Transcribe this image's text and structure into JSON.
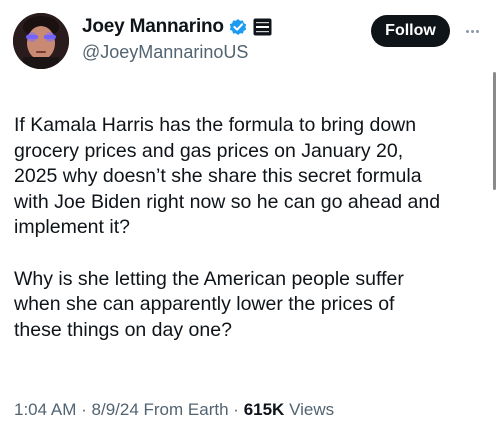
{
  "author": {
    "display_name": "Joey Mannarino",
    "handle": "@JoeyMannarinoUS",
    "verified_badge_icon": "verified-check-icon",
    "affiliate_badge_icon": "affiliate-badge-icon"
  },
  "follow_button": {
    "label": "Follow"
  },
  "more_icon": "more-dots-icon",
  "tweet": {
    "paragraph_1_lines": [
      "If Kamala Harris has the formula to bring down",
      "grocery prices and gas prices on January 20,",
      "2025 why doesn’t she share this secret formula",
      "with Joe Biden right now so he can go ahead and",
      "implement it?"
    ],
    "paragraph_2_lines": [
      "Why is she letting the American people suffer",
      "when she can apparently lower the prices of",
      "these things on day one?"
    ]
  },
  "meta": {
    "time": "1:04 AM",
    "date": "8/9/24",
    "source": "From Earth",
    "separator": "·",
    "views_count": "615K",
    "views_label": "Views"
  },
  "colors": {
    "text": "#0f1419",
    "muted": "#536471",
    "verified_blue": "#1d9bf0",
    "button_bg": "#0f1419",
    "avatar_eyes": "#5b4dff"
  }
}
